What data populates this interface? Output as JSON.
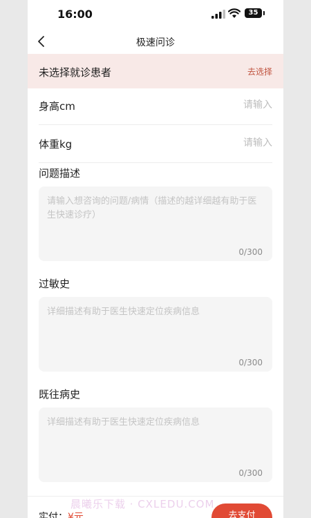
{
  "status_bar": {
    "time": "16:00",
    "battery": "35"
  },
  "nav": {
    "title": "极速问诊"
  },
  "patient": {
    "text": "未选择就诊患者",
    "action": "去选择"
  },
  "height": {
    "label": "身高cm",
    "placeholder": "请输入"
  },
  "weight": {
    "label": "体重kg",
    "placeholder": "请输入"
  },
  "problem": {
    "title": "问题描述",
    "placeholder": "请输入想咨询的问题/病情（描述的越详细越有助于医生快速诊疗）",
    "counter": "0/300"
  },
  "allergy": {
    "title": "过敏史",
    "placeholder": "详细描述有助于医生快速定位疾病信息",
    "counter": "0/300"
  },
  "history": {
    "title": "既往病史",
    "placeholder": "详细描述有助于医生快速定位疾病信息",
    "counter": "0/300"
  },
  "bottom": {
    "pay_label": "实付：",
    "amount": "¥元",
    "pay_button": "去支付"
  },
  "watermark": "晨曦乐下载 · CXLEDU.COM",
  "colors": {
    "accent": "#e14a35",
    "banner_bg": "#f8e9e7",
    "link": "#c0533f"
  }
}
